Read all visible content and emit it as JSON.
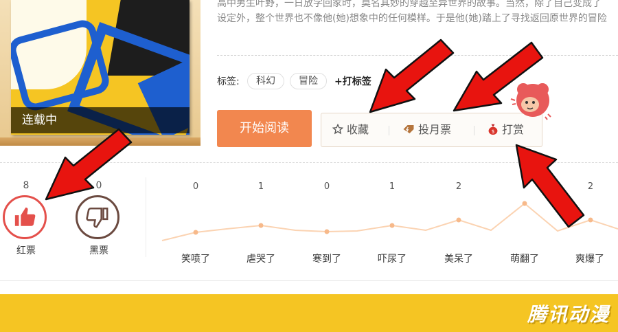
{
  "cover": {
    "status": "连载中"
  },
  "description": {
    "line1": "高中男生叶野，一日放学回家时，莫名其妙的穿越至异世界的故事。当然，除了自己变成了",
    "line2": "设定外，整个世界也不像他(她)想象中的任何模样。于是他(她)踏上了寻找返回原世界的冒险"
  },
  "tags": {
    "label": "标签:",
    "items": [
      "科幻",
      "冒险"
    ],
    "add_label": "+打标签"
  },
  "actions": {
    "read_label": "开始阅读",
    "favorite_label": "收藏",
    "monthly_ticket_label": "投月票",
    "reward_label": "打赏"
  },
  "votes": {
    "red": {
      "count": "8",
      "label": "红票"
    },
    "black": {
      "count": "0",
      "label": "黑票"
    }
  },
  "reactions": [
    {
      "count": "0",
      "label": "笑喷了"
    },
    {
      "count": "1",
      "label": "虐哭了"
    },
    {
      "count": "0",
      "label": "寒到了"
    },
    {
      "count": "1",
      "label": "吓尿了"
    },
    {
      "count": "2",
      "label": "美呆了"
    },
    {
      "count": "",
      "label": "萌翻了"
    },
    {
      "count": "2",
      "label": "爽爆了"
    }
  ],
  "footer": {
    "logo": "腾讯动漫"
  },
  "colors": {
    "primary": "#f2874f",
    "footer": "#f5c523",
    "arrow": "#e8140f",
    "trend_line": "#fbd3b2"
  }
}
